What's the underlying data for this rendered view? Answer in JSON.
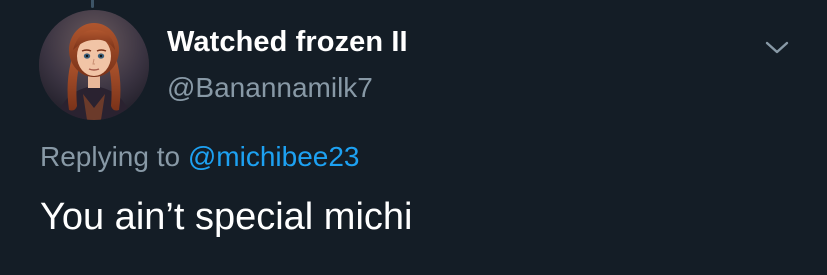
{
  "tweet": {
    "author": {
      "display_name": "Watched frozen II",
      "handle": "@Banannamilk7",
      "avatar": "anna-frozen-avatar"
    },
    "reply": {
      "prefix": "Replying to",
      "mention": "@michibee23"
    },
    "text": "You ain’t special michi",
    "menu_icon": "chevron-down-icon"
  },
  "colors": {
    "background": "#141d26",
    "primary_text": "#ffffff",
    "secondary_text": "#8899a6",
    "link": "#1da1f2"
  }
}
